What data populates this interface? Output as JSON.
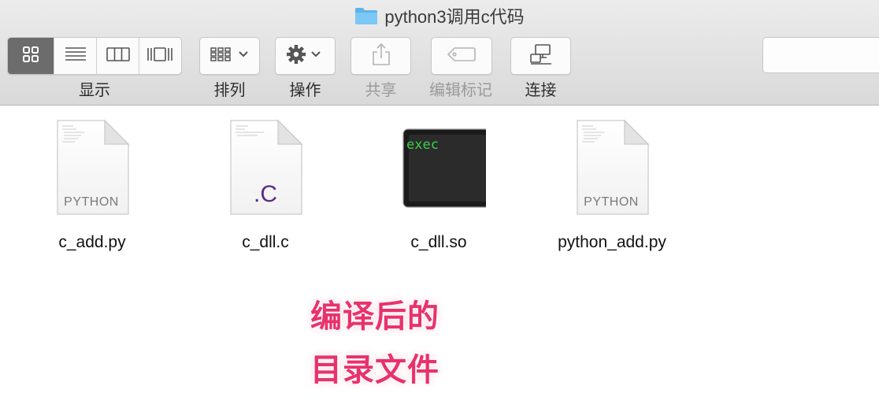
{
  "window": {
    "title": "python3调用c代码",
    "title_icon": "folder-icon"
  },
  "toolbar": {
    "view_label": "显示",
    "arrange_label": "排列",
    "action_label": "操作",
    "share_label": "共享",
    "tags_label": "编辑标记",
    "connect_label": "连接"
  },
  "search": {
    "placeholder": ""
  },
  "files": [
    {
      "name": "c_add.py",
      "kind": "PYTHON",
      "icon": "python-file-icon"
    },
    {
      "name": "c_dll.c",
      "kind": ".C",
      "icon": "c-file-icon"
    },
    {
      "name": "c_dll.so",
      "kind": "exec",
      "icon": "exec-file-icon"
    },
    {
      "name": "python_add.py",
      "kind": "PYTHON",
      "icon": "python-file-icon"
    }
  ],
  "annotation": {
    "line1": "编译后的",
    "line2": "目录文件"
  },
  "colors": {
    "annotation": "#e8326b",
    "c_ext": "#5b2a86",
    "exec_text": "#3bd14a"
  }
}
